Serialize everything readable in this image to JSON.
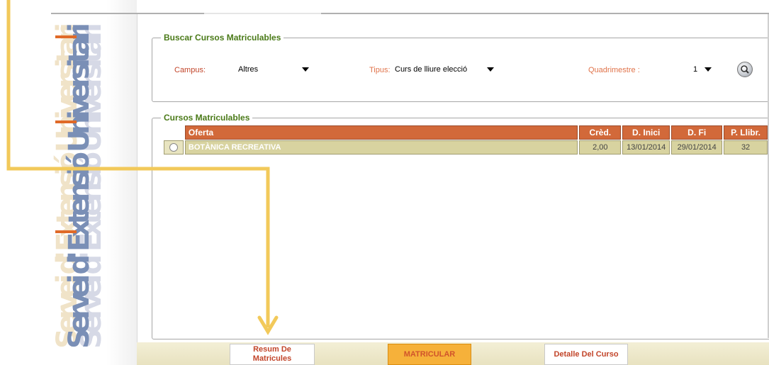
{
  "sidebar": {
    "logo_text": "Servei d' Extensió Universitària"
  },
  "search": {
    "legend": "Buscar Cursos Matriculables",
    "campus_label": "Campus:",
    "campus_value": "Altres",
    "tipus_label": "Tipus:",
    "tipus_value": "Curs de lliure elecció",
    "quadrimestre_label": "Quadrimestre :",
    "quadrimestre_value": "1",
    "search_icon": "magnifier-icon"
  },
  "courses": {
    "legend": "Cursos Matriculables",
    "columns": [
      "Oferta",
      "Crèd.",
      "D. Inici",
      "D. Fi",
      "P. Llibr."
    ],
    "rows": [
      {
        "oferta": "BOTÀNICA RECREATIVA",
        "cred": "2,00",
        "inici": "13/01/2014",
        "fi": "29/01/2014",
        "places": "32"
      }
    ]
  },
  "actions": {
    "resum_line1": "Resum De",
    "resum_line2": "Matricules",
    "matricular": "MATRICULAR",
    "detalle": "Detalle Del Curso"
  },
  "colors": {
    "accent_orange": "#d2693a",
    "legend_green": "#4a7a18",
    "arrow_yellow": "#f2c95a",
    "row_olive": "#d8d3a0"
  }
}
